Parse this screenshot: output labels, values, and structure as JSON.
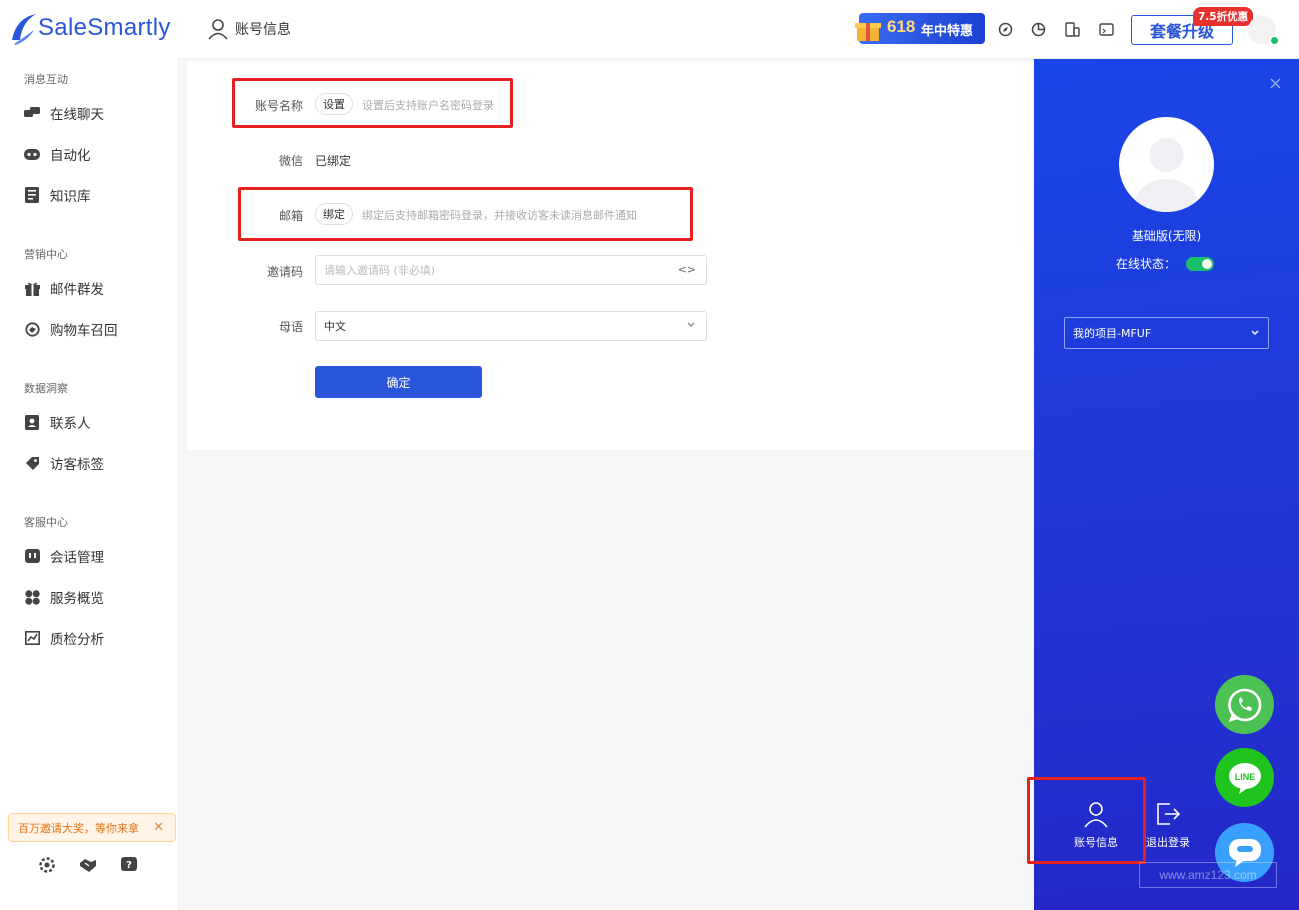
{
  "brand": {
    "name": "SaleSmartly",
    "color": "#2a56d9"
  },
  "sidebar": {
    "sections": [
      {
        "title": "消息互动",
        "items": [
          {
            "label": "在线聊天",
            "icon": "chat-icon"
          },
          {
            "label": "自动化",
            "icon": "robot-icon"
          },
          {
            "label": "知识库",
            "icon": "book-icon"
          }
        ]
      },
      {
        "title": "营销中心",
        "items": [
          {
            "label": "邮件群发",
            "icon": "gift-icon"
          },
          {
            "label": "购物车召回",
            "icon": "cart-recall-icon"
          }
        ]
      },
      {
        "title": "数据洞察",
        "items": [
          {
            "label": "联系人",
            "icon": "contact-icon"
          },
          {
            "label": "访客标签",
            "icon": "tag-icon"
          }
        ]
      },
      {
        "title": "客服中心",
        "items": [
          {
            "label": "会话管理",
            "icon": "session-icon"
          },
          {
            "label": "服务概览",
            "icon": "grid-icon"
          },
          {
            "label": "质检分析",
            "icon": "chart-icon"
          }
        ]
      }
    ],
    "promo": {
      "text": "百万邀请大奖，等你来拿",
      "close": "✕"
    },
    "bottom_icons": [
      "gear-icon",
      "handshake-icon",
      "help-icon"
    ]
  },
  "header": {
    "title": "账号信息",
    "promo_number": "618",
    "promo_text": "年中特惠",
    "upgrade_label": "套餐升级",
    "discount_badge": "7.5折优惠"
  },
  "form": {
    "account_name": {
      "label": "账号名称",
      "button": "设置",
      "hint": "设置后支持账户名密码登录"
    },
    "wechat": {
      "label": "微信",
      "value": "已绑定"
    },
    "email": {
      "label": "邮箱",
      "button": "绑定",
      "hint": "绑定后支持邮箱密码登录，并接收访客未读消息邮件通知"
    },
    "invite": {
      "label": "邀请码",
      "placeholder": "请输入邀请码 (非必填)",
      "right_icon": "<>"
    },
    "language": {
      "label": "母语",
      "value": "中文"
    },
    "submit": "确定"
  },
  "panel": {
    "close": "×",
    "plan": "基础版(无限)",
    "online_label": "在线状态：",
    "online": true,
    "project": "我的项目-MFUF",
    "account_btn": "账号信息",
    "logout_btn": "退出登录"
  },
  "watermark": "www.amz123.com",
  "colors": {
    "primary": "#2a56d9",
    "panel": "#1f3ad6",
    "green": "#19be6b",
    "whatsapp": "#4cc254",
    "line": "#1fc41f",
    "highlight": "#e52020"
  }
}
